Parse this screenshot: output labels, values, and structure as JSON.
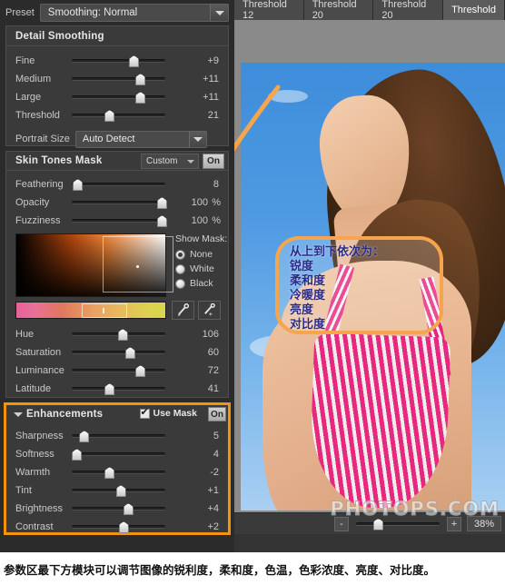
{
  "preset": {
    "label": "Preset",
    "value": "Smoothing: Normal"
  },
  "detail_smoothing": {
    "title": "Detail Smoothing",
    "sliders": [
      {
        "label": "Fine",
        "value": "+9",
        "pos": 66
      },
      {
        "label": "Medium",
        "value": "+11",
        "pos": 73
      },
      {
        "label": "Large",
        "value": "+11",
        "pos": 73
      },
      {
        "label": "Threshold",
        "value": "21",
        "pos": 40
      }
    ],
    "portrait_size": {
      "label": "Portrait Size",
      "value": "Auto Detect"
    }
  },
  "skin_tones_mask": {
    "title": "Skin Tones Mask",
    "preset": "Custom",
    "toggle": "On",
    "sliders": [
      {
        "label": "Feathering",
        "value": "8",
        "unit": "",
        "pos": 6
      },
      {
        "label": "Opacity",
        "value": "100",
        "unit": "%",
        "pos": 96
      },
      {
        "label": "Fuzziness",
        "value": "100",
        "unit": "%",
        "pos": 96
      }
    ],
    "show_mask": {
      "title": "Show Mask:",
      "options": [
        {
          "label": "None",
          "selected": true
        },
        {
          "label": "White",
          "selected": false
        },
        {
          "label": "Black",
          "selected": false
        }
      ]
    },
    "tools": [
      {
        "name": "eyedropper-icon"
      },
      {
        "name": "eyedropper-add-icon"
      }
    ],
    "color_sliders": [
      {
        "label": "Hue",
        "value": "106",
        "pos": 54
      },
      {
        "label": "Saturation",
        "value": "60",
        "pos": 62
      },
      {
        "label": "Luminance",
        "value": "72",
        "pos": 73
      },
      {
        "label": "Latitude",
        "value": "41",
        "pos": 40
      }
    ]
  },
  "enhancements": {
    "title": "Enhancements",
    "use_mask_label": "Use Mask",
    "use_mask_checked": true,
    "toggle": "On",
    "highlight_color": "#f59310",
    "sliders": [
      {
        "label": "Sharpness",
        "value": "5",
        "pos": 13
      },
      {
        "label": "Softness",
        "value": "4",
        "pos": 5
      },
      {
        "label": "Warmth",
        "value": "-2",
        "pos": 40
      },
      {
        "label": "Tint",
        "value": "+1",
        "pos": 52
      },
      {
        "label": "Brightness",
        "value": "+4",
        "pos": 60
      },
      {
        "label": "Contrast",
        "value": "+2",
        "pos": 55
      }
    ]
  },
  "tabs": [
    {
      "label": "Threshold 12",
      "active": false
    },
    {
      "label": "Threshold 20",
      "active": false
    },
    {
      "label": "Threshold 20",
      "active": false
    },
    {
      "label": "Threshold",
      "active": true
    }
  ],
  "callout": {
    "lines": [
      "从上到下依次为：",
      "锐度",
      "柔和度",
      "冷暖度",
      "亮度",
      "对比度"
    ],
    "border_color": "#f5a64c"
  },
  "statusbar": {
    "zoom_out": "-",
    "zoom_in": "+",
    "zoom_level": "38%"
  },
  "watermark": "PHOTOPS.COM",
  "caption": "参数区最下方模块可以调节图像的锐利度，柔和度，色温，色彩浓度、亮度、对比度。"
}
